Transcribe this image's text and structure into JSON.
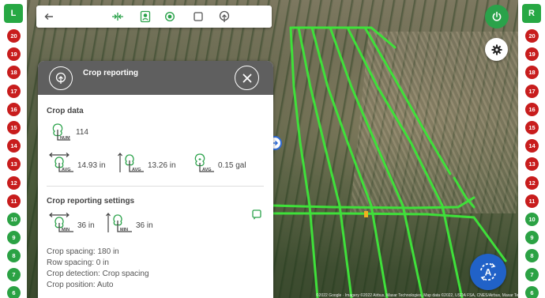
{
  "rails": {
    "left_label": "L",
    "right_label": "R",
    "sections": [
      {
        "n": "20",
        "state": "red"
      },
      {
        "n": "19",
        "state": "red"
      },
      {
        "n": "18",
        "state": "red"
      },
      {
        "n": "17",
        "state": "red"
      },
      {
        "n": "16",
        "state": "red"
      },
      {
        "n": "15",
        "state": "red"
      },
      {
        "n": "14",
        "state": "red"
      },
      {
        "n": "13",
        "state": "red"
      },
      {
        "n": "12",
        "state": "red"
      },
      {
        "n": "11",
        "state": "red"
      },
      {
        "n": "10",
        "state": "green"
      },
      {
        "n": "9",
        "state": "green"
      },
      {
        "n": "8",
        "state": "green"
      },
      {
        "n": "7",
        "state": "green"
      },
      {
        "n": "6",
        "state": "green"
      }
    ]
  },
  "panel": {
    "title": "Crop reporting",
    "crop_data": {
      "heading": "Crop data",
      "count": "114",
      "avg_crop_spacing": "14.93 in",
      "avg_row_spacing": "13.26 in",
      "avg_volume": "0.15 gal",
      "sub_num": "NUM",
      "sub_avg": "AVG"
    },
    "settings": {
      "heading": "Crop reporting settings",
      "min_crop_spacing": "36 in",
      "min_row_spacing": "36 in",
      "sub_min": "MIN",
      "crop_spacing": "Crop spacing: 180 in",
      "row_spacing": "Row spacing: 0 in",
      "crop_detection": "Crop detection: Crop spacing",
      "crop_position": "Crop position: Auto"
    }
  },
  "map": {
    "attribution": "©2022 Google · Imagery ©2022 Airbus, Maxar Technologies, Map data ©2022, USDA FSA, CNES/Airbus, Maxar Tech"
  },
  "colors": {
    "accent_green": "#2aa24a",
    "alert_red": "#c81d1d",
    "auto_blue": "#2162c8",
    "guidance_line": "#3fe03a"
  },
  "icons": [
    "back-arrow-icon",
    "split-lines-icon",
    "map-pin-icon",
    "target-icon",
    "square-icon",
    "upload-icon",
    "power-icon",
    "gear-icon",
    "autosteer-icon",
    "close-icon",
    "edit-icon"
  ]
}
